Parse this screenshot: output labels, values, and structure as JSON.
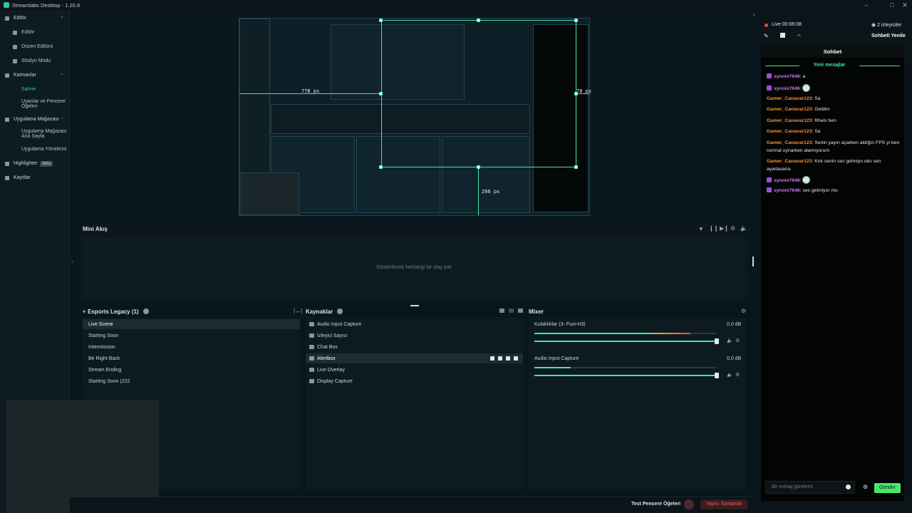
{
  "app": {
    "title": "Streamlabs Desktop - 1.20.9"
  },
  "sidebar": [
    {
      "label": "Editör",
      "section": true
    },
    {
      "label": "Editör",
      "section": false
    },
    {
      "label": "Düzen Editörü",
      "section": false
    },
    {
      "label": "Stüdyo Modu",
      "section": false
    },
    {
      "label": "Katmanlar",
      "section": true
    },
    {
      "label": "Sahne",
      "section": false
    },
    {
      "label": "Uyarılar ve Pencere Öğeleri",
      "section": false
    },
    {
      "label": "Uygulama Mağazası",
      "section": true
    },
    {
      "label": "Uygulama Mağazası Ana Sayfa",
      "section": false
    },
    {
      "label": "Uygulama Yöneticisi",
      "section": false
    },
    {
      "label": "Highlighter",
      "section": true,
      "badge": "beta"
    },
    {
      "label": "Kayıtlar",
      "section": true
    }
  ],
  "preview": {
    "dim_width": "778 px",
    "dim_right": "78 px",
    "dim_height": "266 px"
  },
  "mini": {
    "title": "Mini Akış",
    "empty": "Gösterilecek herhangi bir olay yok"
  },
  "scenes": {
    "title": "Esports Legacy (1)",
    "items": [
      "Live Scene",
      "Starting Soon",
      "Intermission",
      "Be Right Back",
      "Stream Ending",
      "Starting Soon (222"
    ]
  },
  "sources": {
    "title": "Kaynaklar",
    "items": [
      "Audio Input Capture",
      "İzleyici Sayısı",
      "Chat Box",
      "Alertbox",
      "Live Overlay",
      "Display Capture"
    ]
  },
  "mixer": {
    "title": "Mixer",
    "channels": [
      {
        "name": "Kulaklıklar (3- Fuxi-H3)",
        "db": "0.0 dB",
        "level": 0.85
      },
      {
        "name": "Audio Input Capture",
        "db": "0.0 dB",
        "level": 0.2
      }
    ]
  },
  "chat": {
    "live": "Live 00:06:08",
    "viewers": "2 izleyiciler",
    "refresh": "Sohbeti Yenile",
    "tab": "Sohbet",
    "new_messages": "Yeni mesajlar",
    "messages": [
      {
        "user": "synoix7646",
        "text": "a",
        "color": "p"
      },
      {
        "user": "synoix7646",
        "text": "",
        "color": "p",
        "emote": true
      },
      {
        "user": "Gamer_Canavar123",
        "text": "Sa",
        "color": "o"
      },
      {
        "user": "Gamer_Canavar123",
        "text": "Geldim",
        "color": "o"
      },
      {
        "user": "Gamer_Canavar123",
        "text": "Rheix ben",
        "color": "o"
      },
      {
        "user": "Gamer_Canavar123",
        "text": "Sa",
        "color": "o"
      },
      {
        "user": "Gamer_Canavar123",
        "text": "Senin yayın açarken aldığın FPS yi ben normal oynarken alamıyorum",
        "color": "o"
      },
      {
        "user": "Gamer_Canavar123",
        "text": "Knk senin ses gelmiyo obs sen ayarlasana",
        "color": "o"
      },
      {
        "user": "synoix7646",
        "text": "",
        "color": "p",
        "emote": true
      },
      {
        "user": "synoix7646",
        "text": "ses gelmiyor mu",
        "color": "p"
      }
    ],
    "placeholder": "Bir mesaj gönderin",
    "send": "Gönder"
  },
  "footer": {
    "test": "Test Pencere Öğeleri",
    "end": "Yayını Sonlandır"
  }
}
